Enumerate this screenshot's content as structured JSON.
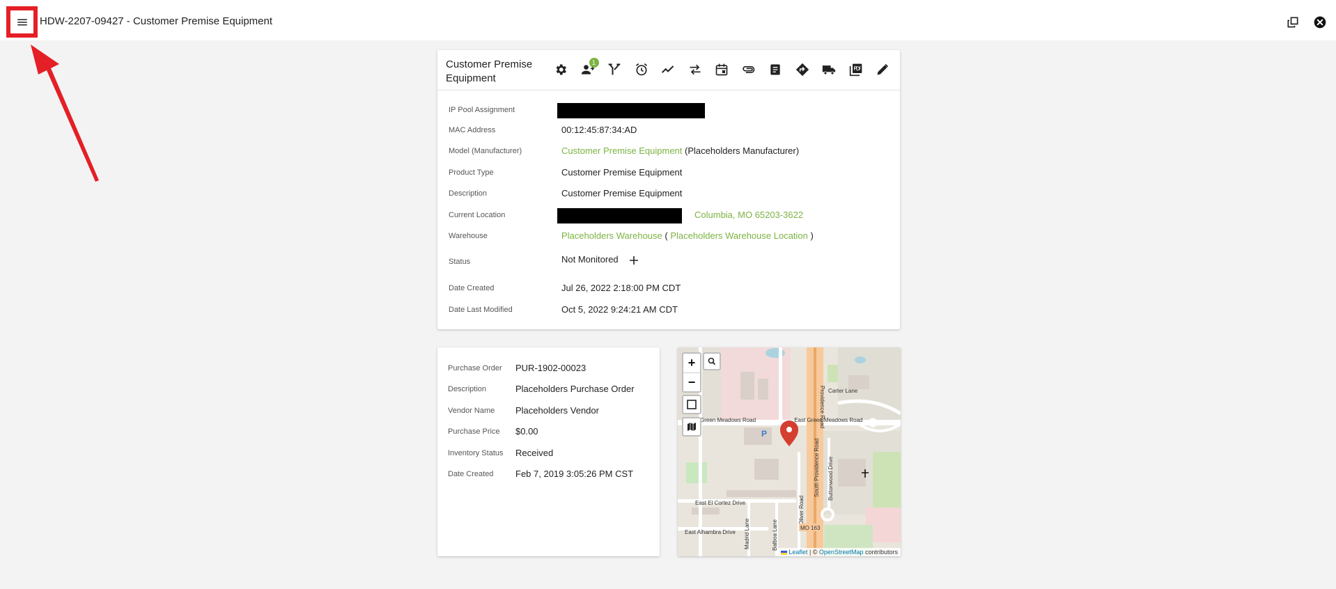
{
  "app": {
    "title": "HDW-2207-09427 - Customer Premise Equipment"
  },
  "header_actions": [
    {
      "icon": "open-in-new-window-icon"
    },
    {
      "icon": "close-circle-icon"
    }
  ],
  "equipment": {
    "card_title": "Customer Premise Equipment",
    "toolbar": [
      {
        "icon": "gear-icon"
      },
      {
        "icon": "assign-user-icon",
        "badge": "1"
      },
      {
        "icon": "fork-icon"
      },
      {
        "icon": "alarm-clock-icon"
      },
      {
        "icon": "trending-icon"
      },
      {
        "icon": "swap-arrows-icon"
      },
      {
        "icon": "calendar-icon"
      },
      {
        "icon": "paperclip-icon"
      },
      {
        "icon": "document-icon"
      },
      {
        "icon": "directions-icon"
      },
      {
        "icon": "truck-icon"
      },
      {
        "icon": "pdf-icon"
      },
      {
        "icon": "pencil-icon"
      }
    ],
    "fields": {
      "ip_pool": {
        "label": "IP Pool Assignment"
      },
      "mac": {
        "label": "MAC Address",
        "value": "00:12:45:87:34:AD"
      },
      "model": {
        "label": "Model (Manufacturer)",
        "link": "Customer Premise Equipment",
        "suffix": "(Placeholders Manufacturer)"
      },
      "product_type": {
        "label": "Product Type",
        "value": "Customer Premise Equipment"
      },
      "description": {
        "label": "Description",
        "value": "Customer Premise Equipment"
      },
      "location": {
        "label": "Current Location",
        "link": "Columbia, MO 65203-3622"
      },
      "warehouse": {
        "label": "Warehouse",
        "link": "Placeholders Warehouse",
        "open": "(",
        "link2": "Placeholders Warehouse Location",
        "close": ")"
      },
      "status": {
        "label": "Status",
        "value": "Not Monitored"
      },
      "date_created": {
        "label": "Date Created",
        "value": "Jul 26, 2022 2:18:00 PM CDT"
      },
      "date_modified": {
        "label": "Date Last Modified",
        "value": "Oct 5, 2022 9:24:21 AM CDT"
      }
    }
  },
  "purchase": {
    "order": {
      "label": "Purchase Order",
      "value": "PUR-1902-00023"
    },
    "description": {
      "label": "Description",
      "value": "Placeholders Purchase Order"
    },
    "vendor": {
      "label": "Vendor Name",
      "value": "Placeholders Vendor"
    },
    "price": {
      "label": "Purchase Price",
      "value": "$0.00"
    },
    "inventory_status": {
      "label": "Inventory Status",
      "value": "Received"
    },
    "date_created": {
      "label": "Date Created",
      "value": "Feb 7, 2019 3:05:26 PM CST"
    }
  },
  "map": {
    "zoom_in": "+",
    "zoom_out": "−",
    "streets": {
      "green_meadows_w": "Green Meadows Road",
      "green_meadows_e": "← East Green Meadows Road",
      "providence": "Providence Road",
      "south_providence": "South Providence Road",
      "carter": "Carter Lane",
      "el_cortez": "East El Cortez Drive",
      "alhambra": "East Alhambra Drive",
      "buttonwood": "Buttonwood Drive",
      "oliver": "Oliver Road",
      "madrid": "Madrid Lane",
      "balboa": "Balboa Lane",
      "route": "MO 163"
    },
    "parking": "P",
    "attribution": {
      "leaflet": "Leaflet",
      "sep": " | © ",
      "osm": "OpenStreetMap",
      "tail": " contributors"
    }
  },
  "colors": {
    "accent": "#7cb342",
    "annotation": "#e41f26",
    "marker": "#d43f2f"
  }
}
